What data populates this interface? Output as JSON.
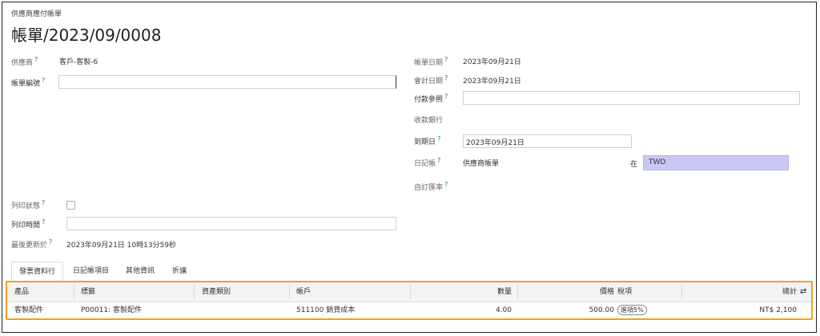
{
  "breadcrumb": "供應商應付帳單",
  "title": "帳單/2023/09/0008",
  "left": {
    "vendor_label": "供應商",
    "vendor_value": "客戶-客製-6",
    "bill_ref_label": "帳單編號",
    "bill_ref_value": "",
    "print_status_label": "列印狀態",
    "print_time_label": "列印時間",
    "print_time_value": "",
    "last_updated_label": "最後更新於",
    "last_updated_value": "2023年09月21日 10時13分59秒"
  },
  "right": {
    "bill_date_label": "帳單日期",
    "bill_date_value": "2023年09月21日",
    "accounting_date_label": "會計日期",
    "accounting_date_value": "2023年09月21日",
    "payment_ref_label": "付款參照",
    "payment_ref_value": "",
    "recipient_bank_label": "收款銀行",
    "due_date_label": "到期日",
    "due_date_value": "2023年09月21日",
    "journal_label": "日記帳",
    "journal_value": "供應商帳單",
    "in_label": "在",
    "currency_value": "TWD",
    "custom_rate_label": "自訂匯率"
  },
  "tabs": [
    "發票資料行",
    "日記帳項目",
    "其他資訊",
    "折讓"
  ],
  "table": {
    "headers": {
      "product": "產品",
      "label": "標籤",
      "asset_type": "資產類別",
      "account": "帳戶",
      "quantity": "數量",
      "price": "價格",
      "taxes": "稅項",
      "total": "總計"
    },
    "rows": [
      {
        "product": "客製配件",
        "label": "P00011: 客製配件",
        "asset_type": "",
        "account": "511100 銷貨成本",
        "quantity": "4.00",
        "price": "500.00",
        "taxes": "進項5%",
        "total": "NT$ 2,100"
      }
    ]
  },
  "colors": {
    "currency_bg": "#c9c8f4",
    "highlight_border": "#f0a020",
    "help_mark": "#0a7a8a"
  },
  "icons": {
    "help": "?",
    "column_settings": "⇄"
  }
}
